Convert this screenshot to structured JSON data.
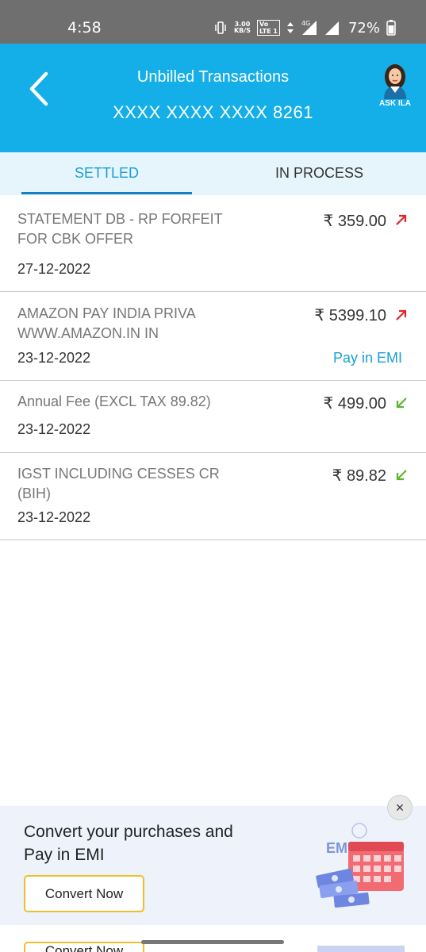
{
  "status_bar": {
    "time": "4:58",
    "speed_value": "3.00",
    "speed_unit": "KB/S",
    "lte_label_top": "Vo",
    "lte_label": "LTE 1",
    "network": "4G",
    "battery": "72%"
  },
  "header": {
    "title": "Unbilled Transactions",
    "card_number": "XXXX XXXX XXXX 8261",
    "assistant_label": "ASK ILA",
    "accent_color": "#14aee8"
  },
  "tabs": [
    {
      "label": "SETTLED",
      "active": true
    },
    {
      "label": "IN PROCESS",
      "active": false
    }
  ],
  "transactions": [
    {
      "description": "STATEMENT DB - RP FORFEIT FOR CBK OFFER",
      "date": "27-12-2022",
      "amount": "₹ 359.00",
      "direction": "debit",
      "emi_label": ""
    },
    {
      "description": "AMAZON PAY INDIA PRIVA WWW.AMAZON.IN IN",
      "date": "23-12-2022",
      "amount": "₹ 5399.10",
      "direction": "debit",
      "emi_label": "Pay in EMI"
    },
    {
      "description": "Annual Fee (EXCL TAX 89.82)",
      "date": "23-12-2022",
      "amount": "₹ 499.00",
      "direction": "credit",
      "emi_label": ""
    },
    {
      "description": "IGST INCLUDING CESSES CR (BIH)",
      "date": "23-12-2022",
      "amount": "₹ 89.82",
      "direction": "credit",
      "emi_label": ""
    }
  ],
  "banner": {
    "title": "Convert your purchases and Pay in EMI",
    "button_label": "Convert Now",
    "art_label": "EMI",
    "close_icon": "×",
    "peek_button_label": "Convert Now"
  },
  "colors": {
    "debit_arrow": "#e0262b",
    "credit_arrow": "#5cb531",
    "link": "#1a9fd6"
  }
}
